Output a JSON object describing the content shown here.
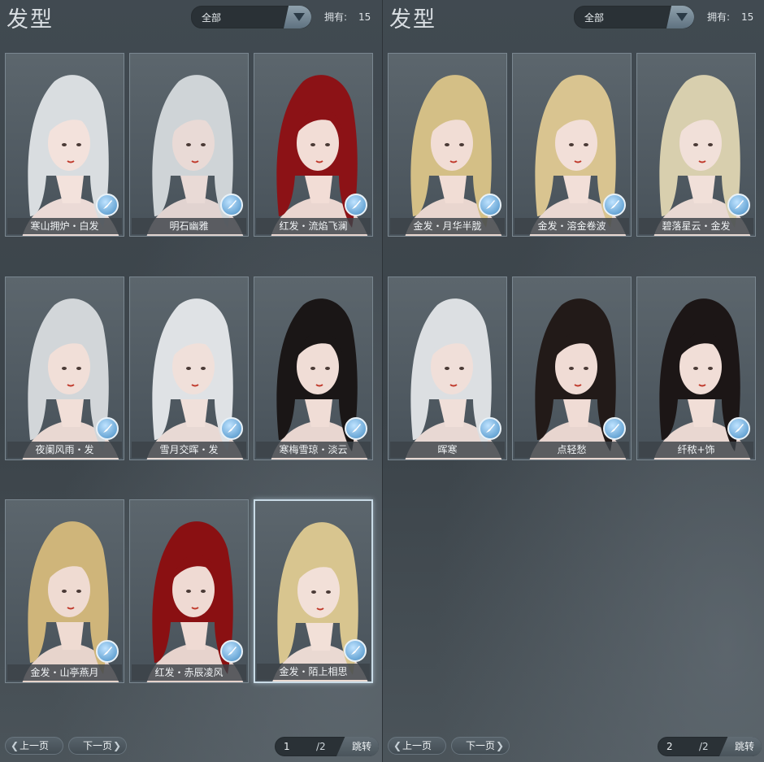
{
  "pages": [
    {
      "title": "发型",
      "filter": {
        "selected": "全部"
      },
      "owned": {
        "label": "拥有:",
        "count": "15"
      },
      "items": [
        {
          "name": "寒山拥炉・白发",
          "hair": "#d9dde0",
          "skin": "#f3e2dc"
        },
        {
          "name": "明石幽雅",
          "hair": "#cfd4d7",
          "skin": "#e9dad6"
        },
        {
          "name": "红发・流焰飞澜",
          "hair": "#8c1216",
          "skin": "#f2ddd6"
        },
        {
          "name": "夜阑风雨・发",
          "hair": "#d2d6d9",
          "skin": "#f1dfd8"
        },
        {
          "name": "雪月交晖・发",
          "hair": "#dfe2e5",
          "skin": "#f0e0da"
        },
        {
          "name": "寒梅雪琼・淡云",
          "hair": "#1a1616",
          "skin": "#f0ddd6"
        },
        {
          "name": "金发・山亭燕月",
          "hair": "#cfb57a",
          "skin": "#efdbd2"
        },
        {
          "name": "红发・赤辰凌风",
          "hair": "#8a1012",
          "skin": "#efdad3"
        },
        {
          "name": "金发・陌上相思",
          "hair": "#d8c58f",
          "skin": "#f2e0d8"
        }
      ],
      "selected_index": 8,
      "pager": {
        "prev": "上一页",
        "next": "下一页",
        "current": "1",
        "total": "/2",
        "jump": "跳转"
      }
    },
    {
      "title": "发型",
      "filter": {
        "selected": "全部"
      },
      "owned": {
        "label": "拥有:",
        "count": "15"
      },
      "items": [
        {
          "name": "金发・月华半胧",
          "hair": "#d4bf86",
          "skin": "#f1ddd5"
        },
        {
          "name": "金发・溶金卷波",
          "hair": "#d9c490",
          "skin": "#f2dfd8"
        },
        {
          "name": "碧落星云・金发",
          "hair": "#d8cfae",
          "skin": "#f1e0d9"
        },
        {
          "name": "晖寒",
          "hair": "#dcdfe2",
          "skin": "#f0dfd9"
        },
        {
          "name": "点轻愁",
          "hair": "#221a18",
          "skin": "#f0dcd5"
        },
        {
          "name": "纤秾+饰",
          "hair": "#1c1616",
          "skin": "#f1ded7"
        }
      ],
      "selected_index": -1,
      "pager": {
        "prev": "上一页",
        "next": "下一页",
        "current": "2",
        "total": "/2",
        "jump": "跳转"
      }
    }
  ]
}
